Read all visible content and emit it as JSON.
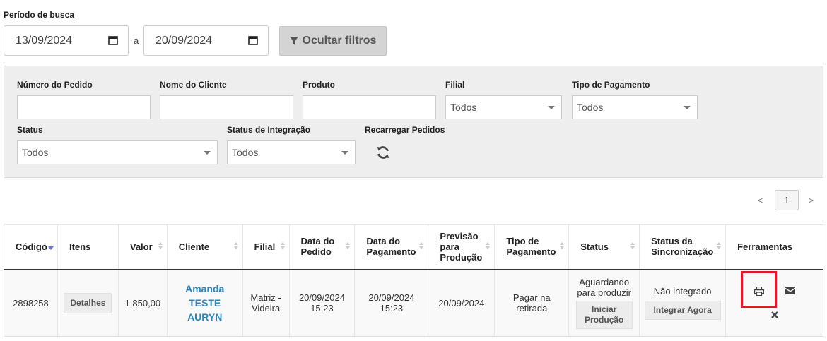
{
  "search_period": {
    "label": "Período de busca",
    "start_date": "13/09/2024",
    "separator": "a",
    "end_date": "20/09/2024",
    "toggle_filters_label": "Ocultar filtros"
  },
  "filters": {
    "order_number_label": "Número do Pedido",
    "client_name_label": "Nome do Cliente",
    "product_label": "Produto",
    "branch_label": "Filial",
    "branch_value": "Todos",
    "payment_type_label": "Tipo de Pagamento",
    "payment_type_value": "Todos",
    "status_label": "Status",
    "status_value": "Todos",
    "integration_status_label": "Status de Integração",
    "integration_status_value": "Todos",
    "reload_label": "Recarregar Pedidos"
  },
  "pagination": {
    "prev": "<",
    "current": "1",
    "next": ">"
  },
  "table": {
    "headers": {
      "code": "Código",
      "items": "Itens",
      "value": "Valor",
      "client": "Cliente",
      "branch": "Filial",
      "order_date": "Data do Pedido",
      "payment_date": "Data do Pagamento",
      "production_forecast": "Previsão para Produção",
      "payment_type": "Tipo de Pagamento",
      "status": "Status",
      "sync_status": "Status da Sincronização",
      "tools": "Ferramentas"
    },
    "rows": [
      {
        "code": "2898258",
        "details_button": "Detalhes",
        "value": "1.850,00",
        "client_line1": "Amanda",
        "client_line2": "TESTE",
        "client_line3": "AURYN",
        "branch": "Matriz - Videira",
        "order_date": "20/09/2024",
        "order_time": "15:23",
        "payment_date": "20/09/2024",
        "payment_time": "15:23",
        "production_forecast": "20/09/2024",
        "payment_type": "Pagar na retirada",
        "status_text": "Aguardando para produzir",
        "start_production_button": "Iniciar Produção",
        "sync_status_text": "Não integrado",
        "integrate_button": "Integrar Agora"
      }
    ]
  },
  "colors": {
    "highlight": "#e0182d",
    "client_link": "#2a87c0",
    "sort_active": "#6b74d6"
  }
}
